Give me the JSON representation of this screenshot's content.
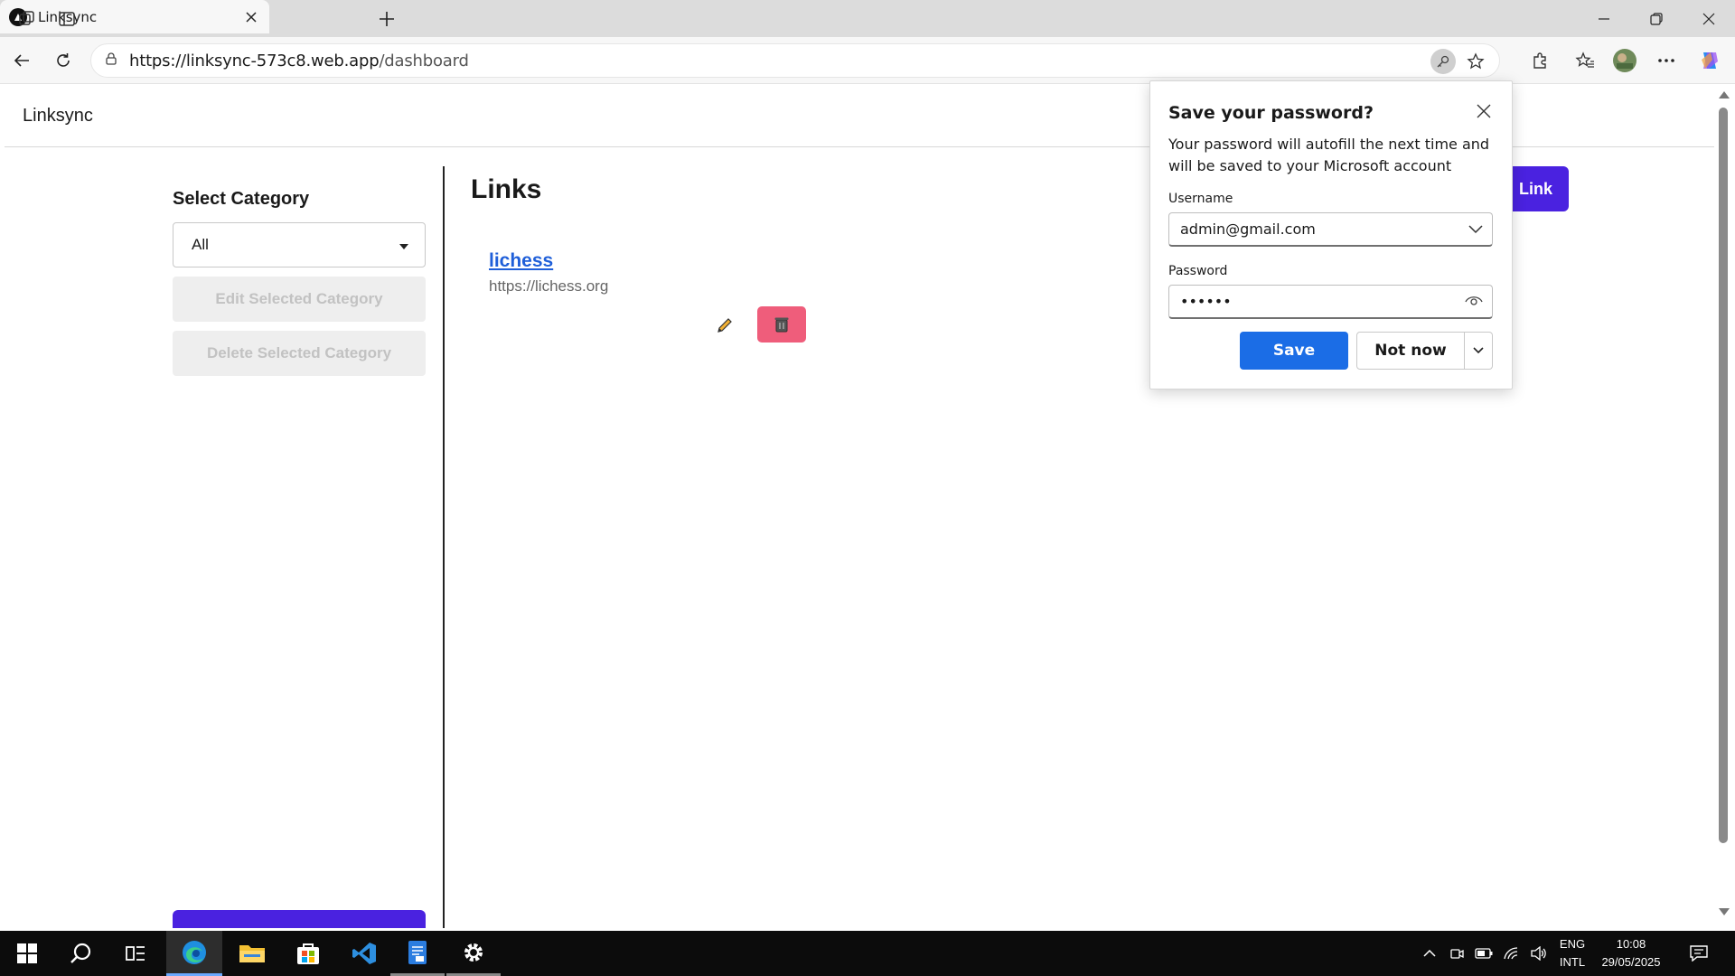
{
  "browser": {
    "tab_title": "Linksync",
    "url_host": "https://linksync-573c8.web.app",
    "url_path": "/dashboard"
  },
  "app": {
    "title": "Linksync",
    "sidebar": {
      "heading": "Select Category",
      "selected_category": "All",
      "edit_button": "Edit Selected Category",
      "delete_button": "Delete Selected Category"
    },
    "links_heading": "Links",
    "add_link_label": "Link",
    "links": [
      {
        "title": "lichess",
        "url": "https://lichess.org"
      }
    ]
  },
  "password_popup": {
    "title": "Save your password?",
    "description": "Your password will autofill the next time and will be saved to your Microsoft account",
    "username_label": "Username",
    "username_value": "admin@gmail.com",
    "password_label": "Password",
    "password_value": "••••••",
    "save_label": "Save",
    "not_now_label": "Not now"
  },
  "taskbar": {
    "lang_top": "ENG",
    "lang_bottom": "INTL",
    "time": "10:08",
    "date": "29/05/2025"
  },
  "colors": {
    "accent": "#4a22e0",
    "save_blue": "#1b6de6",
    "delete_pink": "#ef5d7b",
    "link_blue": "#1f5fd9"
  }
}
